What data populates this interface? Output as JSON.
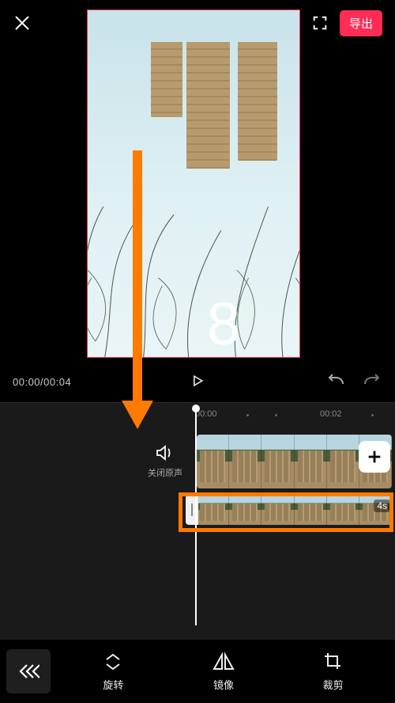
{
  "header": {
    "export_label": "导出"
  },
  "transport": {
    "time_readout": "00:00/00:04"
  },
  "timeline": {
    "ticks": [
      "00:00",
      "00:02"
    ],
    "mute_label": "关闭原声",
    "secondary_duration": "4s"
  },
  "toolbar": {
    "rotate": "旋转",
    "mirror": "镜像",
    "crop": "裁剪"
  },
  "annotation": {
    "step_number": "8"
  }
}
